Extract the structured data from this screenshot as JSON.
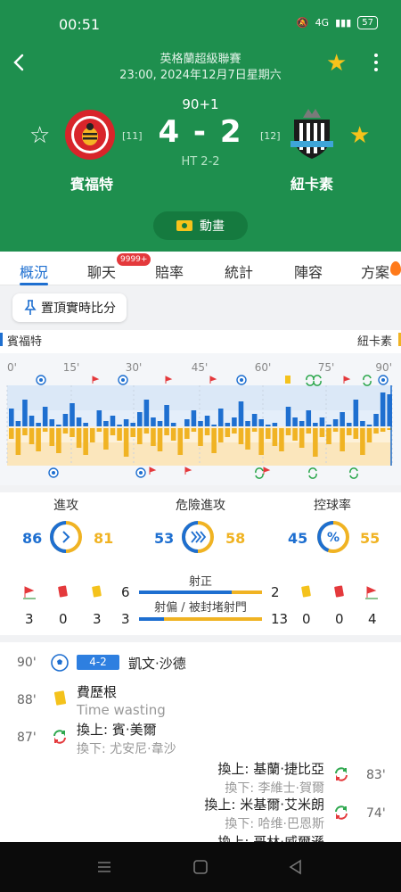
{
  "status": {
    "time": "00:51",
    "battery": "57",
    "network": "4G"
  },
  "header": {
    "league": "英格蘭超級聯賽",
    "kickoff": "23:00, 2024年12月7日星期六",
    "minute": "90+1",
    "score": "4 - 2",
    "half_time": "HT 2-2",
    "home": {
      "name": "賓福特",
      "rank": "[11]"
    },
    "away": {
      "name": "紐卡素",
      "rank": "[12]"
    },
    "animation_label": "動畫"
  },
  "tabs": [
    "概況",
    "聊天",
    "賠率",
    "統計",
    "陣容",
    "方案"
  ],
  "chat_badge": "9999+",
  "pin_label": "置頂實時比分",
  "timeline": {
    "home_label": "賓福特",
    "away_label": "紐卡素",
    "ticks": [
      "0'",
      "15'",
      "30'",
      "45'",
      "60'",
      "75'",
      "90'"
    ]
  },
  "stats": {
    "attack": {
      "label": "進攻",
      "home": "86",
      "away": "81"
    },
    "dangerous": {
      "label": "危險進攻",
      "home": "53",
      "away": "58"
    },
    "possession": {
      "label": "控球率",
      "home": "45",
      "away": "55"
    }
  },
  "shots": {
    "home_corners": "3",
    "home_red": "0",
    "home_yellow": "3",
    "home_on_target": "6",
    "home_off_target": "3",
    "away_on_target": "2",
    "away_off_target": "13",
    "away_yellow": "0",
    "away_red": "0",
    "away_corners": "4",
    "on_target_label": "射正",
    "off_target_label": "射偏 / 被封堵射門"
  },
  "events": [
    {
      "minute": "90'",
      "type": "goal",
      "score": "4-2",
      "text": "凱文·沙德"
    },
    {
      "minute": "88'",
      "type": "yellow",
      "text": "費歷根",
      "note": "Time wasting"
    },
    {
      "minute": "87'",
      "type": "sub",
      "in": "換上: 賓·美爾",
      "out": "換下: 尤安尼·韋沙"
    },
    {
      "minute": "83'",
      "type": "sub",
      "in": "換上: 基蘭·捷比亞",
      "out": "換下: 李維士·賀爾"
    },
    {
      "minute": "74'",
      "type": "sub",
      "in": "換上: 米基爾·艾米朗",
      "out": "換下: 哈维·巴恩斯"
    },
    {
      "minute": "",
      "type": "sub",
      "in": "換上: 哥林·威爾遜",
      "out": ""
    }
  ],
  "colors": {
    "home": "#1e6fd0",
    "away": "#f0b323",
    "header_bg": "#1e8f4e"
  }
}
